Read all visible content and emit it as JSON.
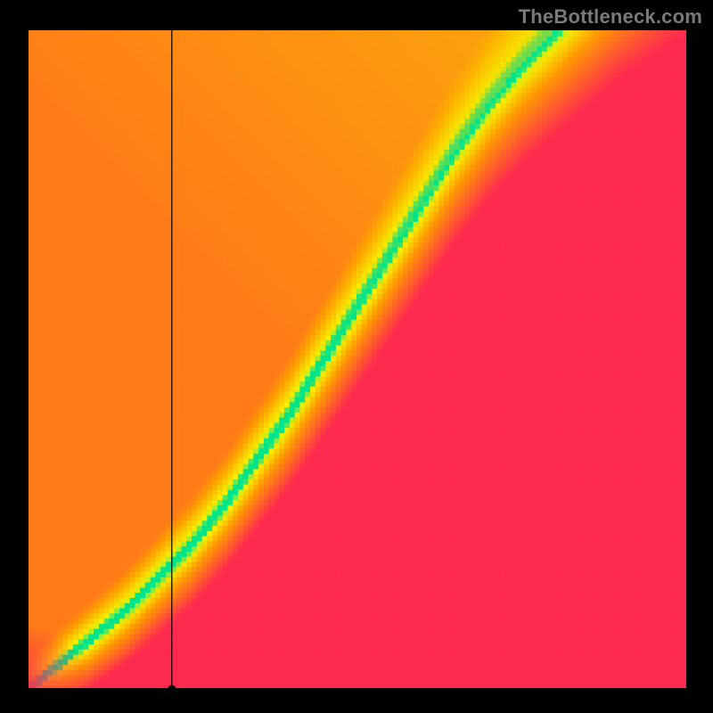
{
  "attribution": "TheBottleneck.com",
  "chart_data": {
    "type": "heatmap",
    "title": "",
    "xlabel": "",
    "ylabel": "",
    "xlim": [
      0,
      1
    ],
    "ylim": [
      0,
      1
    ],
    "grid": false,
    "legend": false,
    "note": "Color encodes suitability: green ≈ optimal, yellow ≈ acceptable, red ≈ bottleneck — inferred from visual gradient, no numeric colorbar shown",
    "marker": {
      "x": 0.22,
      "y": 0.0
    },
    "ridge_curve_x": [
      0.0,
      0.05,
      0.1,
      0.15,
      0.2,
      0.25,
      0.3,
      0.35,
      0.4,
      0.45,
      0.5,
      0.55,
      0.6,
      0.65,
      0.7,
      0.75,
      0.8,
      0.85,
      0.9,
      0.95,
      1.0
    ],
    "ridge_curve_y": [
      0.0,
      0.04,
      0.08,
      0.12,
      0.17,
      0.22,
      0.28,
      0.35,
      0.42,
      0.5,
      0.58,
      0.66,
      0.74,
      0.82,
      0.89,
      0.95,
      1.0,
      1.05,
      1.1,
      1.14,
      1.18
    ],
    "ridge_halfwidth": 0.05,
    "colorstops": {
      "center": "#00E58C",
      "near": "#F6F200",
      "mid": "#FFA000",
      "far": "#FF2A50"
    },
    "heatmap_resolution": 128
  }
}
